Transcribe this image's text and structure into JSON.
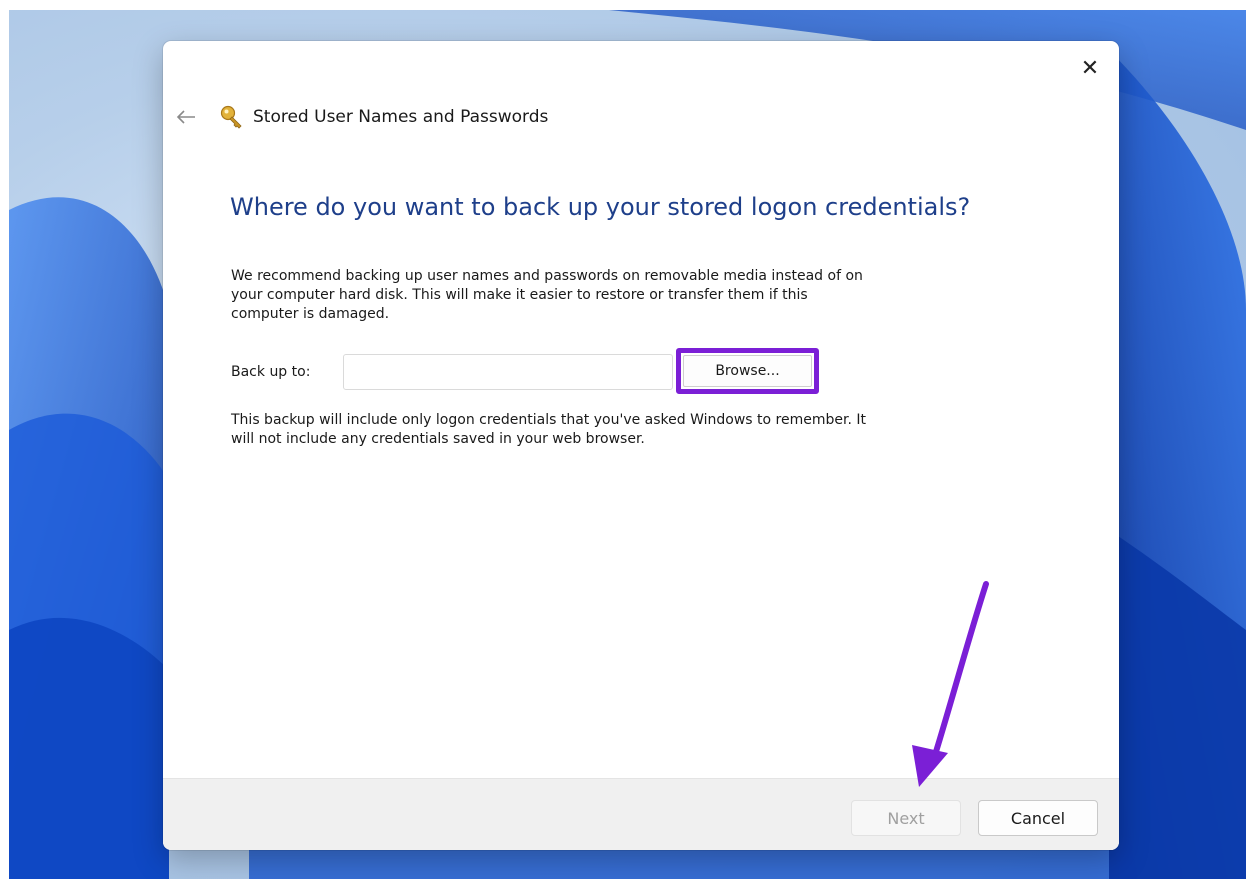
{
  "window": {
    "title": "Stored User Names and Passwords",
    "close_glyph": "✕"
  },
  "content": {
    "heading": "Where do you want to back up your stored logon credentials?",
    "recommendation": "We recommend backing up user names and passwords on removable media instead of on your computer hard disk. This will make it easier to restore or transfer them if this computer is damaged.",
    "backup_label": "Back up to:",
    "backup_value": "",
    "browse_label": "Browse...",
    "note": "This backup will include only logon credentials that you've asked Windows to remember. It will not include any credentials saved in your web browser."
  },
  "footer": {
    "next_label": "Next",
    "cancel_label": "Cancel"
  },
  "icons": {
    "back": "back-arrow-icon",
    "app": "key-icon",
    "close": "close-icon"
  },
  "colors": {
    "heading": "#1e3f8a",
    "highlight": "#7b1fd6",
    "wallpaper": "#1a5fd6"
  }
}
